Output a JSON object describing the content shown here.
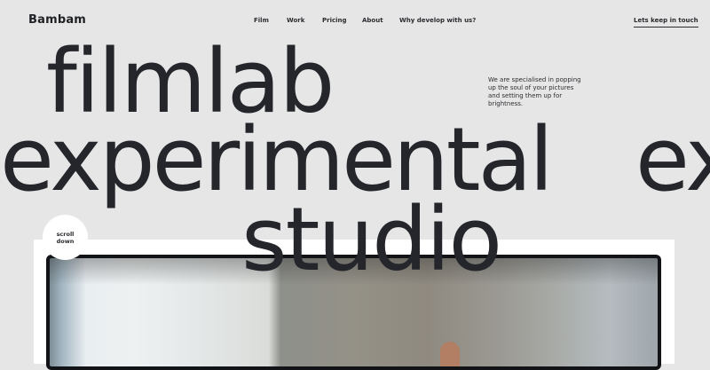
{
  "nav": {
    "brand": "Bambam",
    "items": [
      {
        "label": "Film"
      },
      {
        "label": "Work"
      },
      {
        "label": "Pricing"
      },
      {
        "label": "About"
      },
      {
        "label": "Why develop with us?"
      }
    ],
    "cta": "Lets keep in touch"
  },
  "hero": {
    "line1": "filmlab",
    "line2": "experimental",
    "line2_repeat": "ex",
    "line3": "studio",
    "tagline": "We are specialised in popping up the soul of your pictures and setting them up for brightness."
  },
  "scroll": {
    "label": "scroll down"
  },
  "colors": {
    "background": "#e6e6e6",
    "text": "#24262b",
    "card": "#ffffff",
    "frame": "#121316"
  }
}
